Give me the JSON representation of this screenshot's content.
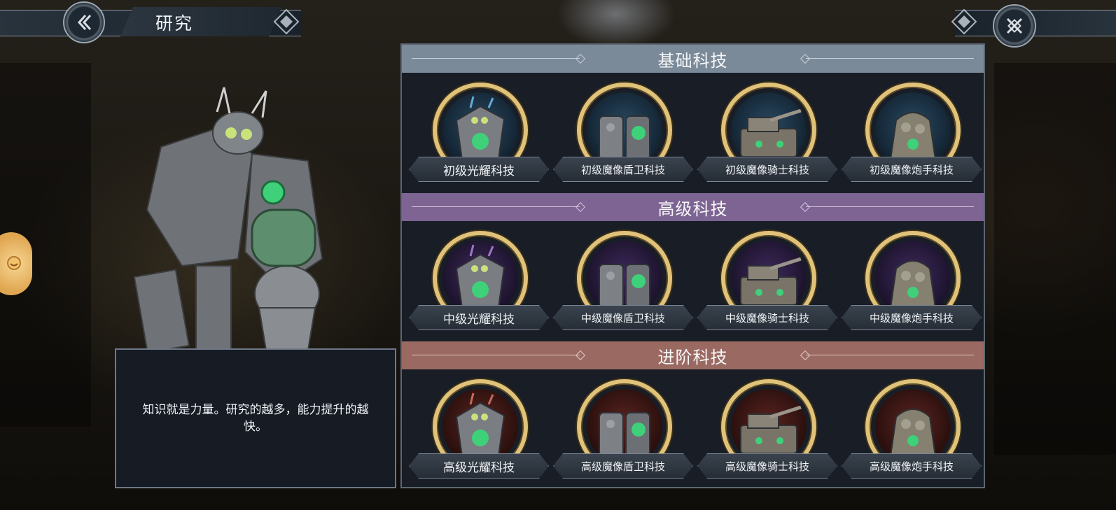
{
  "header": {
    "title": "研究"
  },
  "npc": {
    "dialogue": "知识就是力量。研究的越多，能力提升的越快。"
  },
  "colors": {
    "basic_header": "#7b8a99",
    "advanced_header": "#7d6492",
    "expert_header": "#9a6a62",
    "ring_gold": "#e0c27a"
  },
  "sections": [
    {
      "title": "基础科技",
      "theme": "blue",
      "items": [
        {
          "label": "初级光耀科技",
          "icon": "luminous-golem-icon"
        },
        {
          "label": "初级魔像盾卫科技",
          "icon": "shield-golem-icon"
        },
        {
          "label": "初级魔像骑士科技",
          "icon": "knight-golem-icon"
        },
        {
          "label": "初级魔像炮手科技",
          "icon": "gunner-golem-icon"
        }
      ]
    },
    {
      "title": "高级科技",
      "theme": "purple",
      "items": [
        {
          "label": "中级光耀科技",
          "icon": "luminous-golem-icon"
        },
        {
          "label": "中级魔像盾卫科技",
          "icon": "shield-golem-icon"
        },
        {
          "label": "中级魔像骑士科技",
          "icon": "knight-golem-icon"
        },
        {
          "label": "中级魔像炮手科技",
          "icon": "gunner-golem-icon"
        }
      ]
    },
    {
      "title": "进阶科技",
      "theme": "red",
      "items": [
        {
          "label": "高级光耀科技",
          "icon": "luminous-golem-icon"
        },
        {
          "label": "高级魔像盾卫科技",
          "icon": "shield-golem-icon"
        },
        {
          "label": "高级魔像骑士科技",
          "icon": "knight-golem-icon"
        },
        {
          "label": "高级魔像炮手科技",
          "icon": "gunner-golem-icon"
        }
      ]
    }
  ]
}
